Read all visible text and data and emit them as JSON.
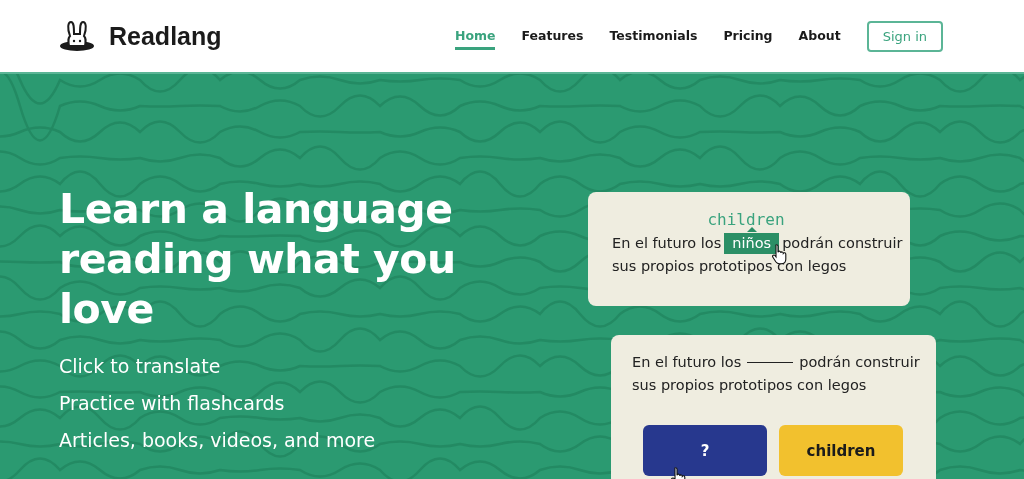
{
  "header": {
    "brand": "Readlang",
    "nav": [
      {
        "label": "Home",
        "selected": true
      },
      {
        "label": "Features",
        "selected": false
      },
      {
        "label": "Testimonials",
        "selected": false
      },
      {
        "label": "Pricing",
        "selected": false
      },
      {
        "label": "About",
        "selected": false
      }
    ],
    "sign_in": "Sign in"
  },
  "hero": {
    "title": "Learn a language reading what you love",
    "points": [
      "Click to translate",
      "Practice with flashcards",
      "Articles, books, videos, and more"
    ]
  },
  "translate_card": {
    "translation": "children",
    "before": "En el futuro los",
    "word": "niños",
    "after": "podrán construir",
    "line_2": "sus propios prototipos con legos"
  },
  "flashcard": {
    "before": "En el futuro los",
    "after": "podrán construir",
    "line_2": "sus propios prototipos con legos",
    "buttons": [
      {
        "label": "?",
        "kind": "hidden"
      },
      {
        "label": "children",
        "kind": "answer"
      }
    ]
  }
}
